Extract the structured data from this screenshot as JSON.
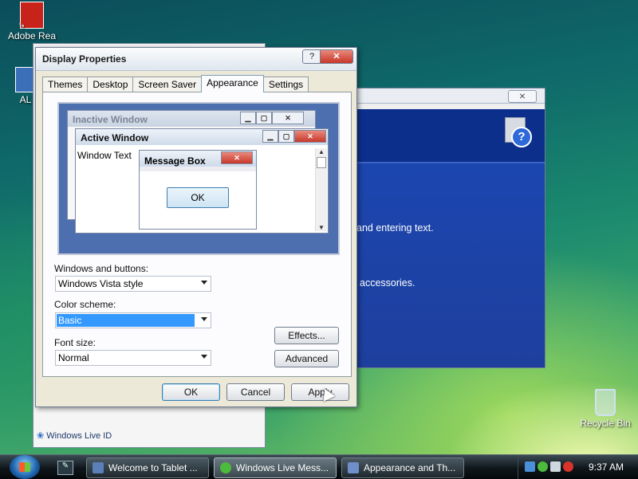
{
  "desktop": {
    "icons": [
      {
        "label": "Adobe Rea"
      },
      {
        "label": "AL"
      },
      {
        "label": "Recycle Bin"
      }
    ]
  },
  "welcome_window": {
    "footer": "Windows Live ID"
  },
  "background_window": {
    "close": "⨯",
    "line1": "and entering text.",
    "line2": "accessories."
  },
  "dialog": {
    "title": "Display Properties",
    "help": "?",
    "close": "✕",
    "tabs": [
      "Themes",
      "Desktop",
      "Screen Saver",
      "Appearance",
      "Settings"
    ],
    "selected_tab": "Appearance",
    "preview": {
      "inactive_title": "Inactive Window",
      "active_title": "Active Window",
      "window_text": "Window Text",
      "msgbox_title": "Message Box",
      "msgbox_ok": "OK"
    },
    "windows_buttons_label": "Windows and buttons:",
    "windows_buttons_value": "Windows Vista style",
    "color_scheme_label": "Color scheme:",
    "color_scheme_value": "Basic",
    "font_size_label": "Font size:",
    "font_size_value": "Normal",
    "effects": "Effects...",
    "advanced": "Advanced",
    "ok": "OK",
    "cancel": "Cancel",
    "apply": "Apply"
  },
  "taskbar": {
    "items": [
      {
        "label": "Welcome to Tablet ..."
      },
      {
        "label": "Windows Live Mess..."
      },
      {
        "label": "Appearance and Th..."
      }
    ],
    "clock": "9:37 AM"
  },
  "colors": {
    "selection": "#3399ff",
    "dialog_bg": "#ece9d8",
    "bg_window_blue": "#1b48b4"
  }
}
